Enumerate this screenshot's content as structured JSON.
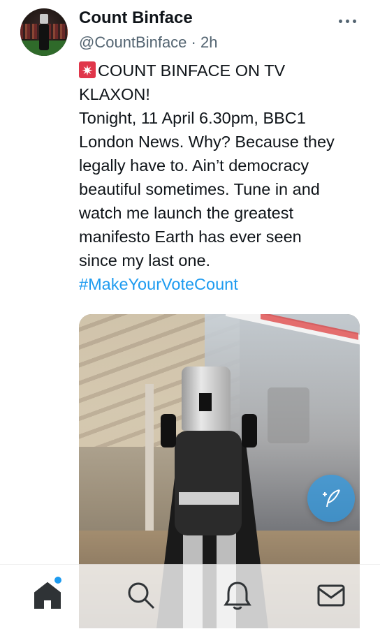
{
  "author": {
    "name": "Count Binface",
    "handle": "@CountBinface",
    "separator": " · ",
    "time": "2h"
  },
  "tweet": {
    "lines": [
      "COUNT BINFACE ON TV",
      "KLAXON!",
      "Tonight, 11 April 6.30pm, BBC1",
      "London News. Why? Because they",
      "legally have to. Ain’t democracy",
      "beautiful sometimes. Tune in and",
      "watch me launch the greatest",
      "manifesto Earth has ever seen",
      "since my last one."
    ],
    "hashtag": "#MakeYourVoteCount",
    "emoji": "siren-emoji"
  },
  "colors": {
    "accent": "#1d9bf0",
    "secondary_text": "#536471",
    "emoji_red": "#e0364a"
  },
  "icons": [
    "more-icon",
    "home-icon",
    "search-icon",
    "notifications-icon",
    "messages-icon",
    "compose-icon"
  ]
}
